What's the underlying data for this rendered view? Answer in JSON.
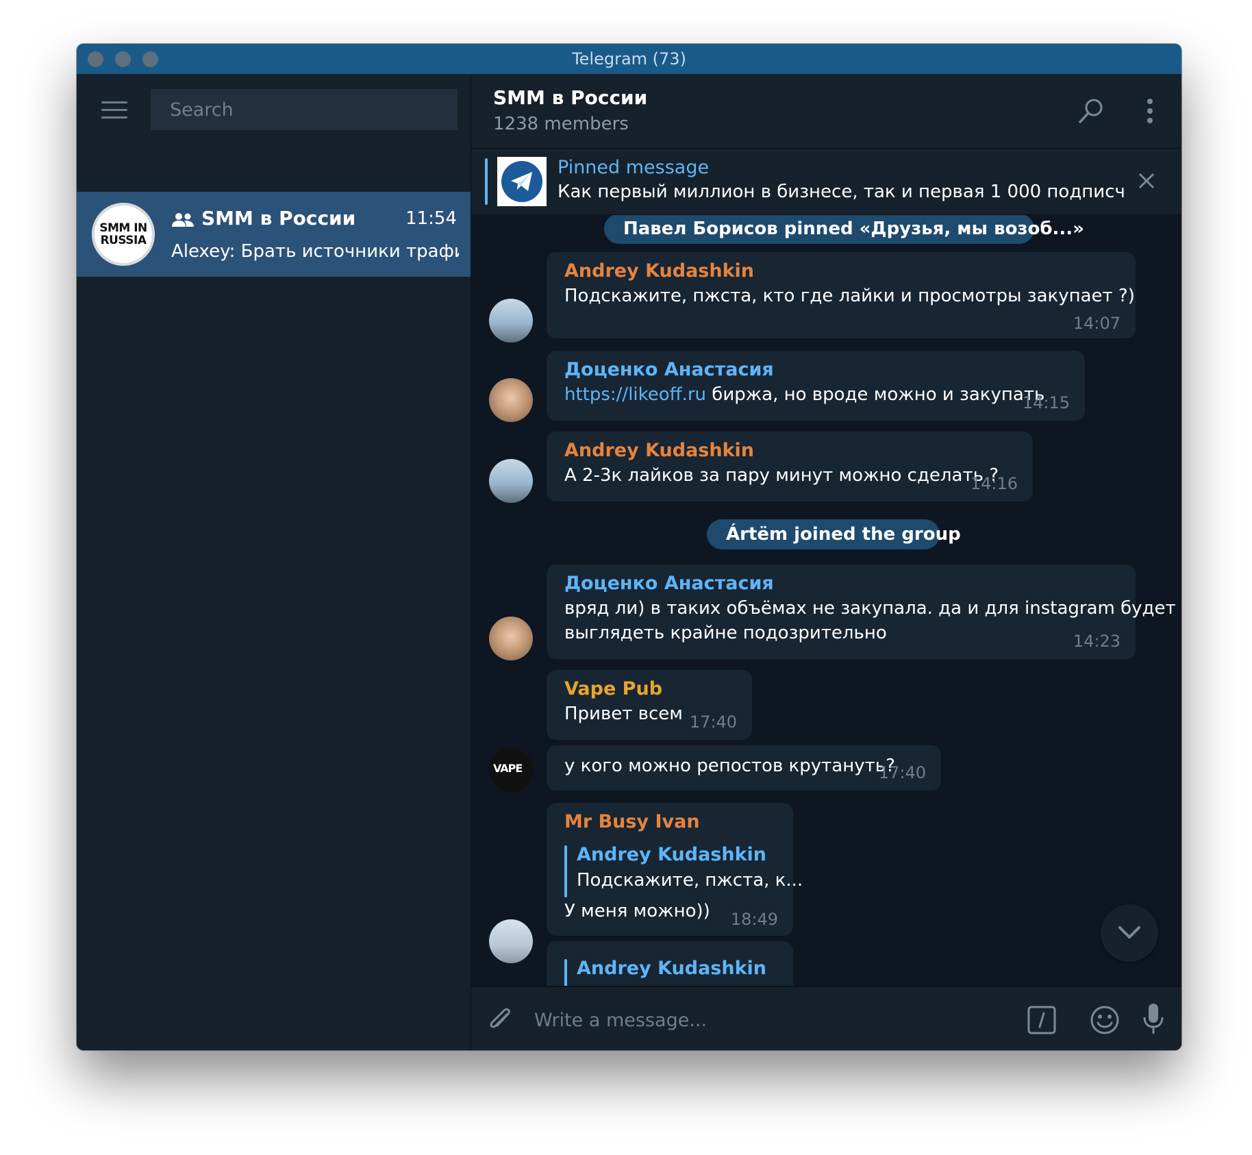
{
  "window": {
    "title": "Telegram (73)"
  },
  "sidebar": {
    "search_placeholder": "Search",
    "chats": [
      {
        "avatar_text": "SMM IN RUSSIA",
        "name": "SMM в России",
        "time": "11:54",
        "preview": "Alexey: Брать источники трафи..."
      }
    ]
  },
  "chat": {
    "title": "SMM в России",
    "subtitle": "1238 members",
    "pinned": {
      "title": "Pinned message",
      "text": "Как первый миллион в бизнесе, так и первая 1 000 подписч..."
    },
    "service_pinned": "Павел Борисов pinned «Друзья, мы возоб...»",
    "service_joined": "Ártëm joined the group",
    "messages": [
      {
        "sender": "Andrey Kudashkin",
        "text": "Подскажите, пжста, кто где лайки и просмотры закупает ?)",
        "time": "14:07"
      },
      {
        "sender": "Доценко Анастасия",
        "link": "https://likeoff.ru",
        "text": " биржа, но вроде можно и закупать",
        "time": "14:15"
      },
      {
        "sender": "Andrey Kudashkin",
        "text": "А 2-3к лайков за пару минут можно сделать ?",
        "time": "14:16"
      },
      {
        "sender": "Доценко Анастасия",
        "text_line1": "вряд ли) в таких объёмах не закупала. да и для instagram будет",
        "text_line2": "выглядеть крайне подозрительно",
        "time": "14:23"
      },
      {
        "sender": "Vape Pub",
        "text": "Привет всем",
        "time": "17:40"
      },
      {
        "text": "у кого можно репостов крутануть?",
        "time": "17:40"
      },
      {
        "sender": "Mr Busy Ivan",
        "reply_name": "Andrey Kudashkin",
        "reply_text": "Подскажите, пжста, к...",
        "text": "У меня можно))",
        "time": "18:49"
      },
      {
        "reply_name": "Andrey Kudashkin"
      }
    ],
    "avatar_vape_text": "VAPE"
  },
  "composer": {
    "placeholder": "Write a message..."
  },
  "colors": {
    "accent": "#5eb5f7",
    "sender_orange": "#e5843d",
    "sender_blue": "#5eb5f7",
    "sender_gold": "#e8a52c",
    "titlebar": "#1a5a89"
  }
}
